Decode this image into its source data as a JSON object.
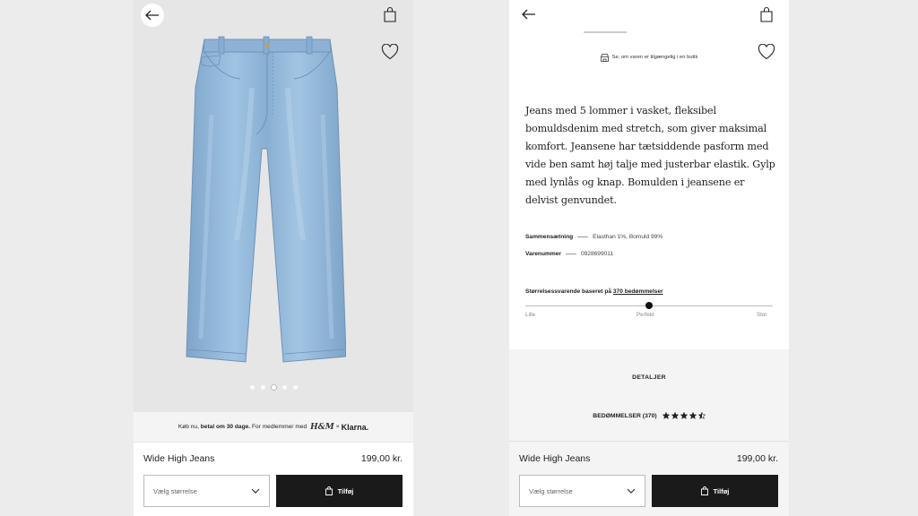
{
  "left_screen": {
    "image_dots": {
      "count": 5,
      "active_index": 2
    },
    "klarna_banner": {
      "prefix": "Køb nu,",
      "bold": "betal om 30 dage.",
      "member_text": "For medlemmer med",
      "hm_logo": "H&M",
      "times": "×",
      "klarna_logo": "Klarna."
    },
    "product": {
      "name": "Wide High Jeans",
      "price": "199,00 kr."
    },
    "size_select": {
      "placeholder": "Vælg størrelse"
    },
    "add_button": {
      "label": "Tilføj"
    }
  },
  "right_screen": {
    "availability": "Se, om varen er tilgængelig i en butik",
    "description": "Jeans med 5 lommer i vasket, fleksibel bomuldsdenim med stretch, som giver maksimal komfort. Jeansene har tætsiddende pasform med vide ben samt høj talje med justerbar elastik. Gylp med lynlås og knap. Bomulden i jeansene er delvist genvundet.",
    "composition": {
      "label": "Sammensætning",
      "value": "Elasthan 1%, Bomuld 99%"
    },
    "article_number": {
      "label": "Varenummer",
      "value": "0928699011"
    },
    "fit": {
      "title_prefix": "Størrelsessvarende baseret på",
      "title_link": "370 bedømmelser",
      "labels": [
        "Lille",
        "Perfekt",
        "Stor"
      ],
      "value": 0.5
    },
    "details_label": "DETALJER",
    "reviews": {
      "label": "BEDØMMELSER (370)",
      "rating": 4.5,
      "max": 5
    },
    "product": {
      "name": "Wide High Jeans",
      "price": "199,00 kr."
    },
    "size_select": {
      "placeholder": "Vælg størrelse"
    },
    "add_button": {
      "label": "Tilføj"
    }
  },
  "colors": {
    "button_bg": "#1a1a1a",
    "page_bg": "#ececec",
    "denim": "#8bb3d6"
  },
  "icons": [
    "back-arrow-icon",
    "shopping-bag-icon",
    "heart-icon",
    "store-icon",
    "chevron-down-icon",
    "star-icon"
  ]
}
